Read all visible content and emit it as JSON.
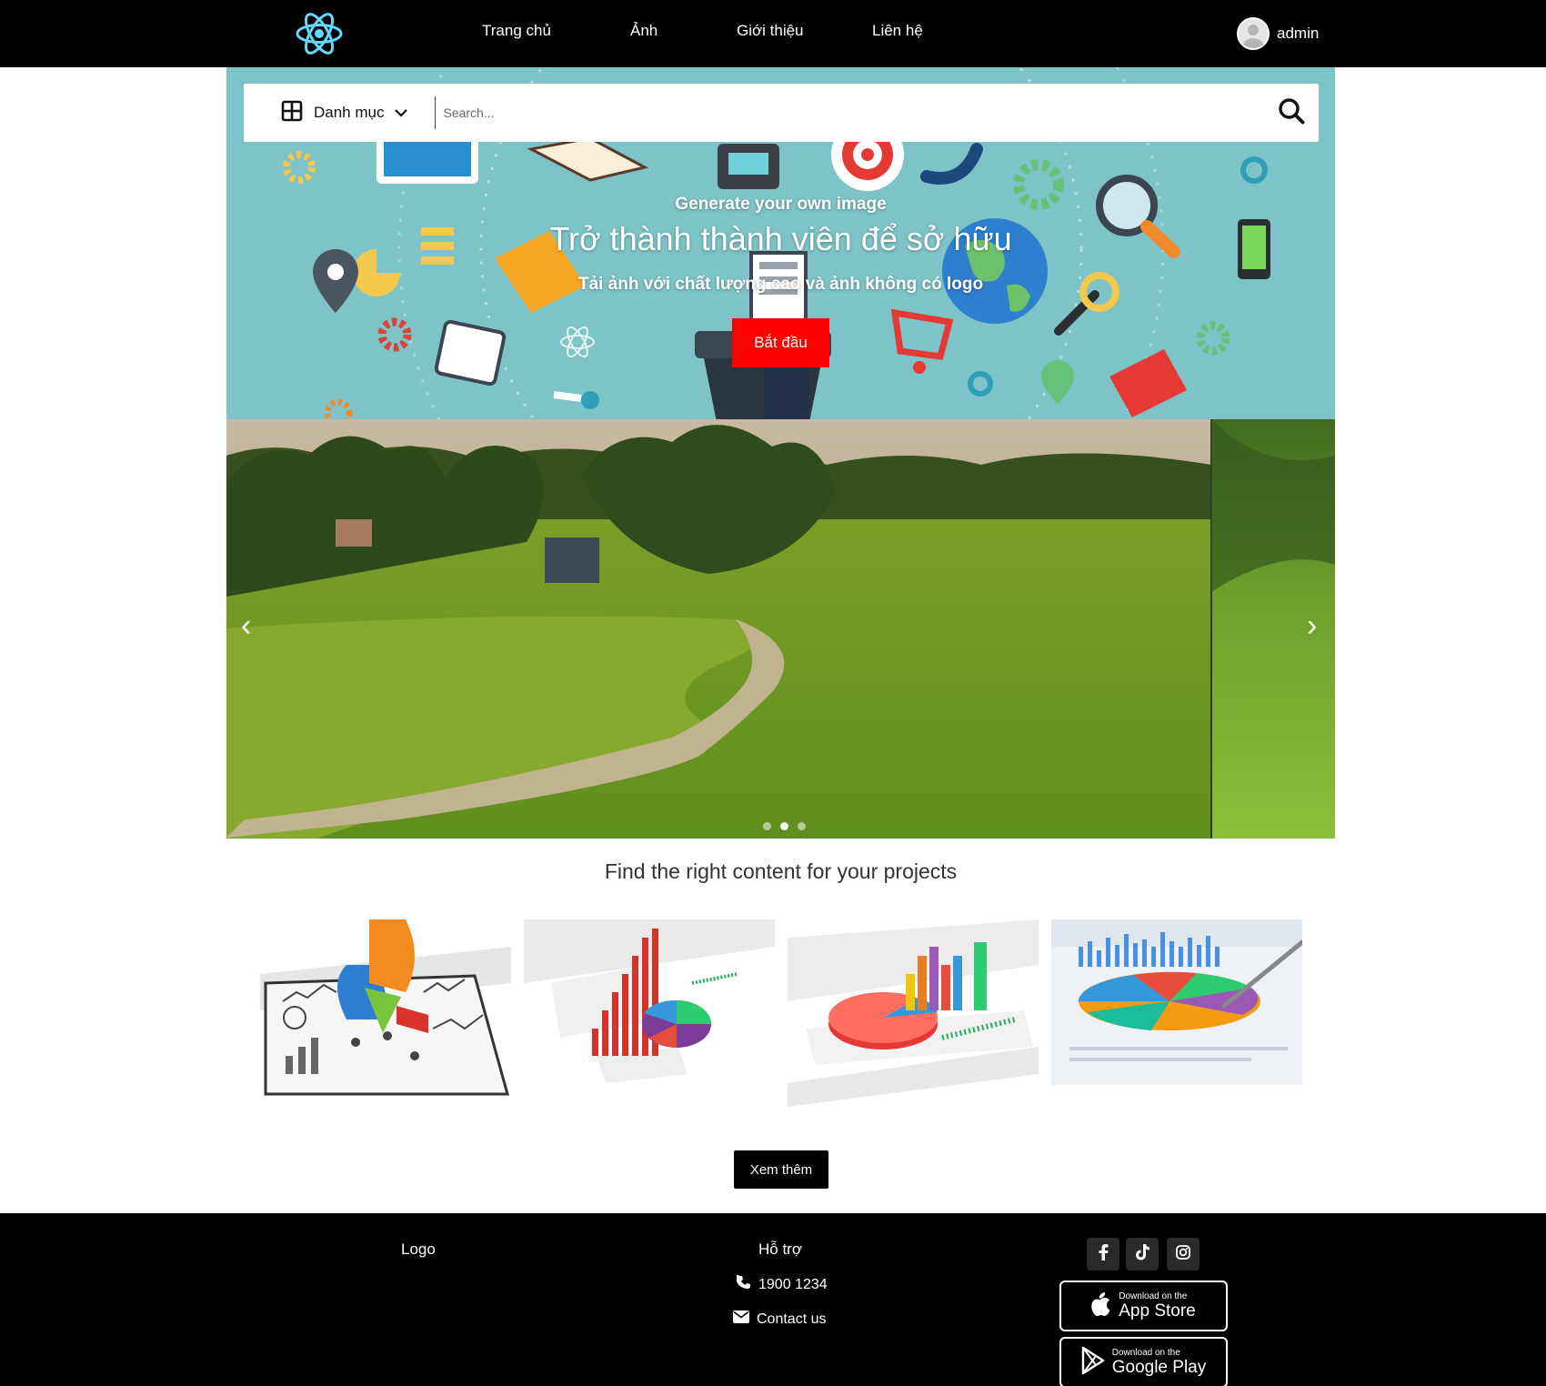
{
  "nav": {
    "links": [
      "Trang chủ",
      "Ảnh",
      "Giới thiệu",
      "Liên hệ"
    ],
    "username": "admin"
  },
  "search": {
    "category_label": "Danh mục",
    "placeholder": "Search..."
  },
  "hero": {
    "kicker": "Generate your own image",
    "title": "Trở thành thành viên để sở hữu",
    "subtitle": "Tải ảnh với chất lượng cao và ảnh không có logo",
    "cta": "Bắt đầu"
  },
  "carousel": {
    "prev": "‹",
    "next": "›",
    "slide_count": 3,
    "active_slide": 2
  },
  "section": {
    "title": "Find the right content for your projects",
    "more_button": "Xem thêm"
  },
  "footer": {
    "logo": "Logo",
    "support_title": "Hỗ trợ",
    "phone": "1900 1234",
    "contact": "Contact us",
    "appstore_small": "Download on the",
    "appstore_big": "App Store",
    "googleplay_small": "Download on the",
    "googleplay_big": "Google Play"
  },
  "colors": {
    "nav_bg": "#000000",
    "cta": "#ff0000",
    "hero_bg": "#7fc4c8",
    "react_logo": "#61dafb"
  }
}
